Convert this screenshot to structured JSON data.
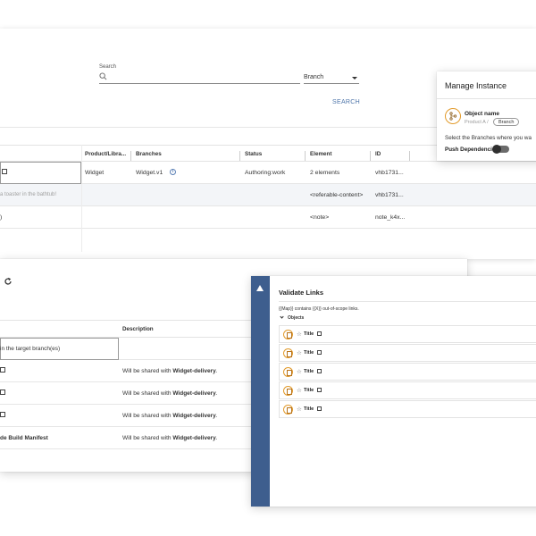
{
  "search": {
    "label": "Search",
    "branch_selected": "Branch",
    "button": "SEARCH"
  },
  "results": {
    "columns": [
      "Product/Libra...",
      "Branches",
      "Status",
      "Element",
      "ID"
    ],
    "rows": [
      {
        "title": "",
        "product": "Widget",
        "branch": "Widget.v1",
        "status": "Authoring:work",
        "element": "2 elements",
        "id": "vhb1731..."
      },
      {
        "title": "a toaster in the bathtub!",
        "product": "",
        "branch": "",
        "status": "",
        "element": "<referable-content>",
        "id": "vhb1731..."
      },
      {
        "title": ")",
        "product": "",
        "branch": "",
        "status": "",
        "element": "<note>",
        "id": "note_k4x..."
      }
    ]
  },
  "manage": {
    "title": "Manage Instance",
    "object_name": "Object name",
    "object_path": "Product A /",
    "branch_chip": "Branch",
    "select_text": "Select the Branches where you wa",
    "push_label": "Push Dependencies",
    "push_enabled": false
  },
  "dependencies": {
    "columns": [
      "Description"
    ],
    "rows": [
      {
        "name": "in the target branch(es)",
        "desc_prefix": "",
        "desc_bold": "",
        "desc_suffix": ""
      },
      {
        "name": "",
        "desc_prefix": "Will be shared with ",
        "desc_bold": "Widget-delivery",
        "desc_suffix": "."
      },
      {
        "name": "",
        "desc_prefix": "Will be shared with ",
        "desc_bold": "Widget-delivery",
        "desc_suffix": "."
      },
      {
        "name": "",
        "desc_prefix": "Will be shared with ",
        "desc_bold": "Widget-delivery",
        "desc_suffix": "."
      },
      {
        "name": "de Build Manifest",
        "desc_prefix": "Will be shared with ",
        "desc_bold": "Widget-delivery",
        "desc_suffix": "."
      }
    ]
  },
  "validate": {
    "title": "Validate Links",
    "message": "{{Map}} contains {{X}} out-of-scope links.",
    "group": "Objects",
    "items": [
      "Title",
      "Title",
      "Title",
      "Title",
      "Title"
    ]
  },
  "colors": {
    "accent": "#3e5e8e",
    "link": "#4b73a8",
    "object_icon": "#e29a2a"
  }
}
